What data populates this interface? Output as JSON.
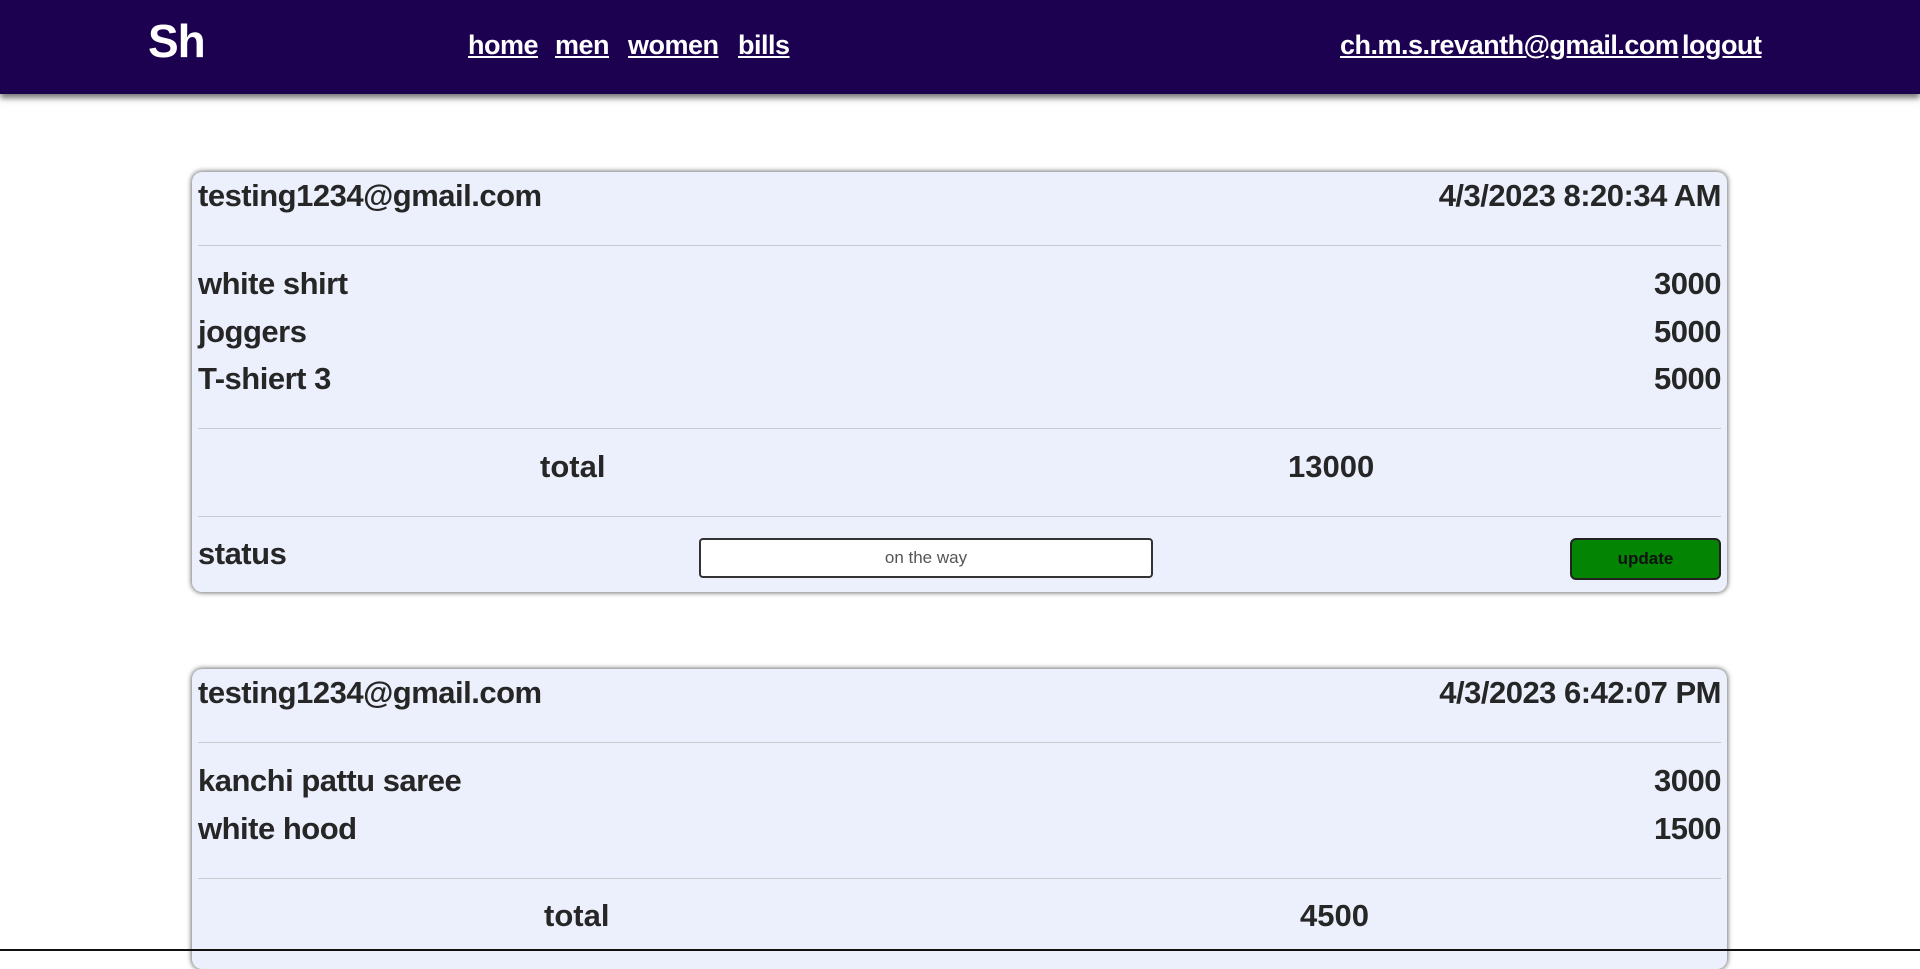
{
  "navbar": {
    "brand": "Sh",
    "links": [
      "home",
      "men",
      "women",
      "bills"
    ],
    "user_email": "ch.m.s.revanth@gmail.com",
    "logout": "logout",
    "background": "#1b0150"
  },
  "bills": [
    {
      "email": "testing1234@gmail.com",
      "datetime": "4/3/2023 8:20:34 AM",
      "items": [
        {
          "name": "white shirt",
          "price": "3000"
        },
        {
          "name": "joggers",
          "price": "5000"
        },
        {
          "name": "T-shiert 3",
          "price": "5000"
        }
      ],
      "total_label": "total",
      "total": "13000",
      "status_label": "status",
      "status_value": "on the way",
      "update_label": "update"
    },
    {
      "email": "testing1234@gmail.com",
      "datetime": "4/3/2023 6:42:07 PM",
      "items": [
        {
          "name": "kanchi pattu saree",
          "price": "3000"
        },
        {
          "name": "white hood",
          "price": "1500"
        }
      ],
      "total_label": "total",
      "total": "4500"
    }
  ],
  "colors": {
    "card_background": "#ecf0fd",
    "update_button": "#038403"
  }
}
